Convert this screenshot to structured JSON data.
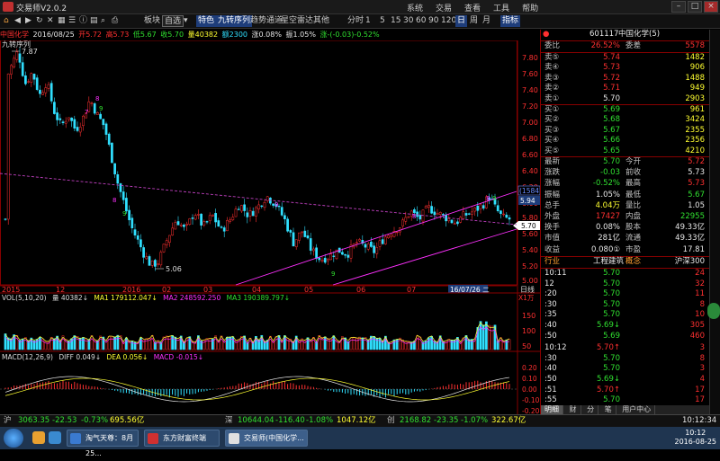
{
  "app": {
    "title": "交易师V2.0.2"
  },
  "menus": [
    "系统",
    "交易",
    "查看",
    "工具",
    "帮助"
  ],
  "toolbar": {
    "items": [
      "板块",
      "自选",
      "特色",
      "九转序列",
      "趋势通道",
      "星空雷达",
      "其他"
    ],
    "periods": [
      "分时",
      "1",
      "5",
      "15",
      "30",
      "60",
      "90",
      "120",
      "日",
      "周",
      "月"
    ],
    "active_period": "日",
    "extra": "指标"
  },
  "chart_header": {
    "name": "中国化学",
    "date": "2016/08/25",
    "open": "开5.72",
    "high": "高5.73",
    "low": "低5.67",
    "close": "收5.70",
    "volume": "量40382",
    "amount": "额2300",
    "change_pct": "涨0.08%",
    "amplitude": "振1.05%",
    "change": "涨-(-0.03)-0.52%",
    "indicator": "九转序列",
    "hi_label": "7.87",
    "lo_label": "5.06"
  },
  "price_axis": [
    "7.80",
    "7.60",
    "7.40",
    "7.20",
    "7.00",
    "6.80",
    "6.60",
    "6.40",
    "6.20",
    "6.00",
    "5.80",
    "5.60",
    "5.40",
    "5.20",
    "5.00"
  ],
  "price_tags": {
    "p1": "(1584)",
    "p2": "5.94",
    "p3": "5.70"
  },
  "x_axis": [
    "2015",
    "12",
    "2016",
    "02",
    "03",
    "04",
    "05",
    "06",
    "07"
  ],
  "date_tag": "16/07/26 二",
  "day_line_label": "日线",
  "unit_label": "X1万",
  "vol_header": {
    "name": "VOL(5,10,20)",
    "vol": "量 40382↓",
    "ma1": "MA1 179112.047↓",
    "ma2": "MA2 248592.250",
    "ma3": "MA3 190389.797↓"
  },
  "vol_axis": [
    "150",
    "100",
    "50"
  ],
  "macd_header": {
    "name": "MACD(12,26,9)",
    "diff": "DIFF 0.049↓",
    "dea": "DEA 0.056↓",
    "macd": "MACD -0.015↓"
  },
  "macd_axis": [
    "0.20",
    "0.10",
    "0.00",
    "-0.10",
    "-0.20"
  ],
  "stock": {
    "code": "601117",
    "name": "中国化学(5)"
  },
  "order_book": {
    "weibi_label": "委比",
    "weibi": "26.52%",
    "weicha_label": "委差",
    "weicha": "5578",
    "sells": [
      {
        "label": "卖⑤",
        "price": "5.74",
        "vol": "1482"
      },
      {
        "label": "卖④",
        "price": "5.73",
        "vol": "906"
      },
      {
        "label": "卖③",
        "price": "5.72",
        "vol": "1488"
      },
      {
        "label": "卖②",
        "price": "5.71",
        "vol": "949"
      },
      {
        "label": "卖①",
        "price": "5.70",
        "vol": "2903"
      }
    ],
    "buys": [
      {
        "label": "买①",
        "price": "5.69",
        "vol": "961"
      },
      {
        "label": "买②",
        "price": "5.68",
        "vol": "3424"
      },
      {
        "label": "买③",
        "price": "5.67",
        "vol": "2355"
      },
      {
        "label": "买④",
        "price": "5.66",
        "vol": "2356"
      },
      {
        "label": "买⑤",
        "price": "5.65",
        "vol": "4210"
      }
    ]
  },
  "quote": [
    {
      "l1": "最新",
      "v1": "5.70",
      "l2": "今开",
      "v2": "5.72"
    },
    {
      "l1": "涨跌",
      "v1": "-0.03",
      "l2": "前收",
      "v2": "5.73"
    },
    {
      "l1": "涨幅",
      "v1": "-0.52%",
      "l2": "最高",
      "v2": "5.73"
    },
    {
      "l1": "振幅",
      "v1": "1.05%",
      "l2": "最低",
      "v2": "5.67"
    },
    {
      "l1": "总手",
      "v1": "4.04万",
      "l2": "量比",
      "v2": "1.05"
    },
    {
      "l1": "外盘",
      "v1": "17427",
      "l2": "内盘",
      "v2": "22955"
    },
    {
      "l1": "换手",
      "v1": "0.08%",
      "l2": "股本",
      "v2": "49.33亿"
    },
    {
      "l1": "市值",
      "v1": "281亿",
      "l2": "流通",
      "v2": "49.33亿"
    },
    {
      "l1": "收益",
      "v1": "0.080①",
      "l2": "市盈",
      "v2": "17.81"
    }
  ],
  "industry": {
    "l1": "行业",
    "v1": "工程建筑",
    "l2": "概念",
    "v2": "沪深300"
  },
  "ticks": [
    {
      "t": "10:11",
      "p": "5.70",
      "v": "24"
    },
    {
      "t": "12",
      "p": "5.70",
      "v": "32"
    },
    {
      "t": ":20",
      "p": "5.70",
      "v": "11"
    },
    {
      "t": ":30",
      "p": "5.70",
      "v": "8"
    },
    {
      "t": ":35",
      "p": "5.70",
      "v": "10"
    },
    {
      "t": ":40",
      "p": "5.69↓",
      "v": "305"
    },
    {
      "t": ":50",
      "p": "5.69",
      "v": "460"
    },
    {
      "t": "10:12",
      "p": "5.70↑",
      "v": "3"
    },
    {
      "t": ":30",
      "p": "5.70",
      "v": "8"
    },
    {
      "t": ":40",
      "p": "5.70",
      "v": "3"
    },
    {
      "t": ":50",
      "p": "5.69↓",
      "v": "4"
    },
    {
      "t": ":51",
      "p": "5.70↑",
      "v": "17"
    },
    {
      "t": ":55",
      "p": "5.70",
      "v": "17"
    }
  ],
  "bottom_tabs": [
    "明细",
    "财",
    "分",
    "笔",
    "用户中心"
  ],
  "status": {
    "sh_label": "沪",
    "sh": "3063.35",
    "sh_chg": "-22.53",
    "sh_pct": "-0.73%",
    "sh_amt": "695.56亿",
    "sz_label": "深",
    "sz": "10644.04",
    "sz_chg": "-116.40",
    "sz_pct": "-1.08%",
    "sz_amt": "1047.12亿",
    "cy_label": "创",
    "cy": "2168.82",
    "cy_chg": "-23.35",
    "cy_pct": "-1.07%",
    "cy_amt": "322.67亿",
    "time": "10:12:34"
  },
  "taskbar": {
    "tasks": [
      "淘气天尊：8月25...",
      "东方财富终端",
      "交易师(中国化学..."
    ],
    "clock_time": "10:12",
    "clock_date": "2016-08-25"
  }
}
